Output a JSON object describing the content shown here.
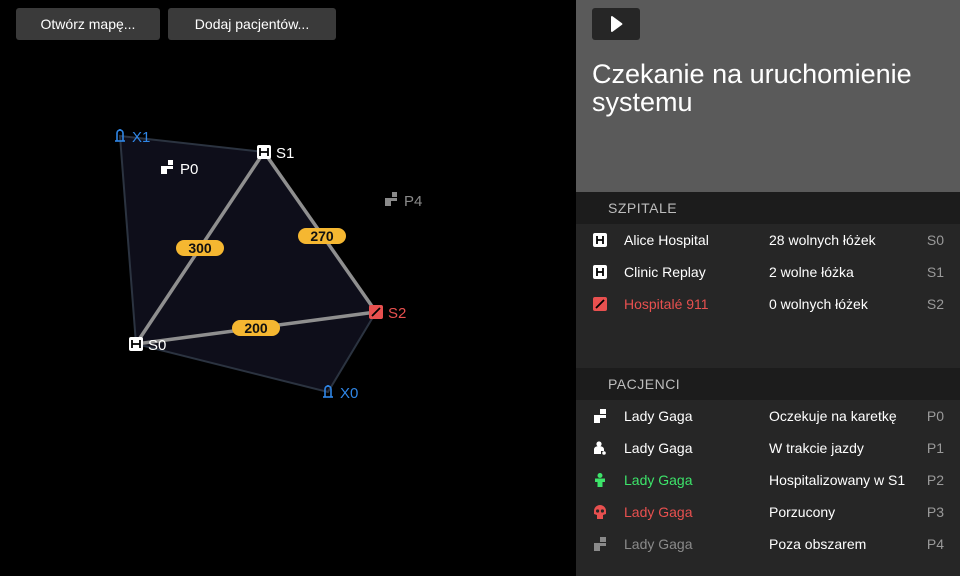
{
  "toolbar": {
    "open_map_label": "Otwórz mapę...",
    "add_patients_label": "Dodaj pacjentów..."
  },
  "map": {
    "nodes": {
      "x1": "X1",
      "p0": "P0",
      "s1": "S1",
      "p4": "P4",
      "s2": "S2",
      "s0": "S0",
      "x0": "X0"
    },
    "edges": {
      "s0_s1": "300",
      "s1_s2": "270",
      "s0_s2": "200"
    }
  },
  "status": {
    "title": "Czekanie na uruchomienie systemu"
  },
  "hospitals": {
    "header": "SZPITALE",
    "items": [
      {
        "name": "Alice Hospital",
        "beds": "28 wolnych łóżek",
        "code": "S0"
      },
      {
        "name": "Clinic Replay",
        "beds": "2 wolne łóżka",
        "code": "S1"
      },
      {
        "name": "Hospitalé 911",
        "beds": "0 wolnych łóżek",
        "code": "S2"
      }
    ]
  },
  "patients": {
    "header": "PACJENCI",
    "items": [
      {
        "name": "Lady Gaga",
        "state": "Oczekuje na karetkę",
        "code": "P0"
      },
      {
        "name": "Lady Gaga",
        "state": "W trakcie jazdy",
        "code": "P1"
      },
      {
        "name": "Lady Gaga",
        "state": "Hospitalizowany w S1",
        "code": "P2"
      },
      {
        "name": "Lady Gaga",
        "state": "Porzucony",
        "code": "P3"
      },
      {
        "name": "Lady Gaga",
        "state": "Poza obszarem",
        "code": "P4"
      }
    ]
  },
  "colors": {
    "accent_blue": "#2f86e6",
    "danger_red": "#e8504f",
    "ok_green": "#3de36a",
    "edge_label": "#f5b731"
  }
}
